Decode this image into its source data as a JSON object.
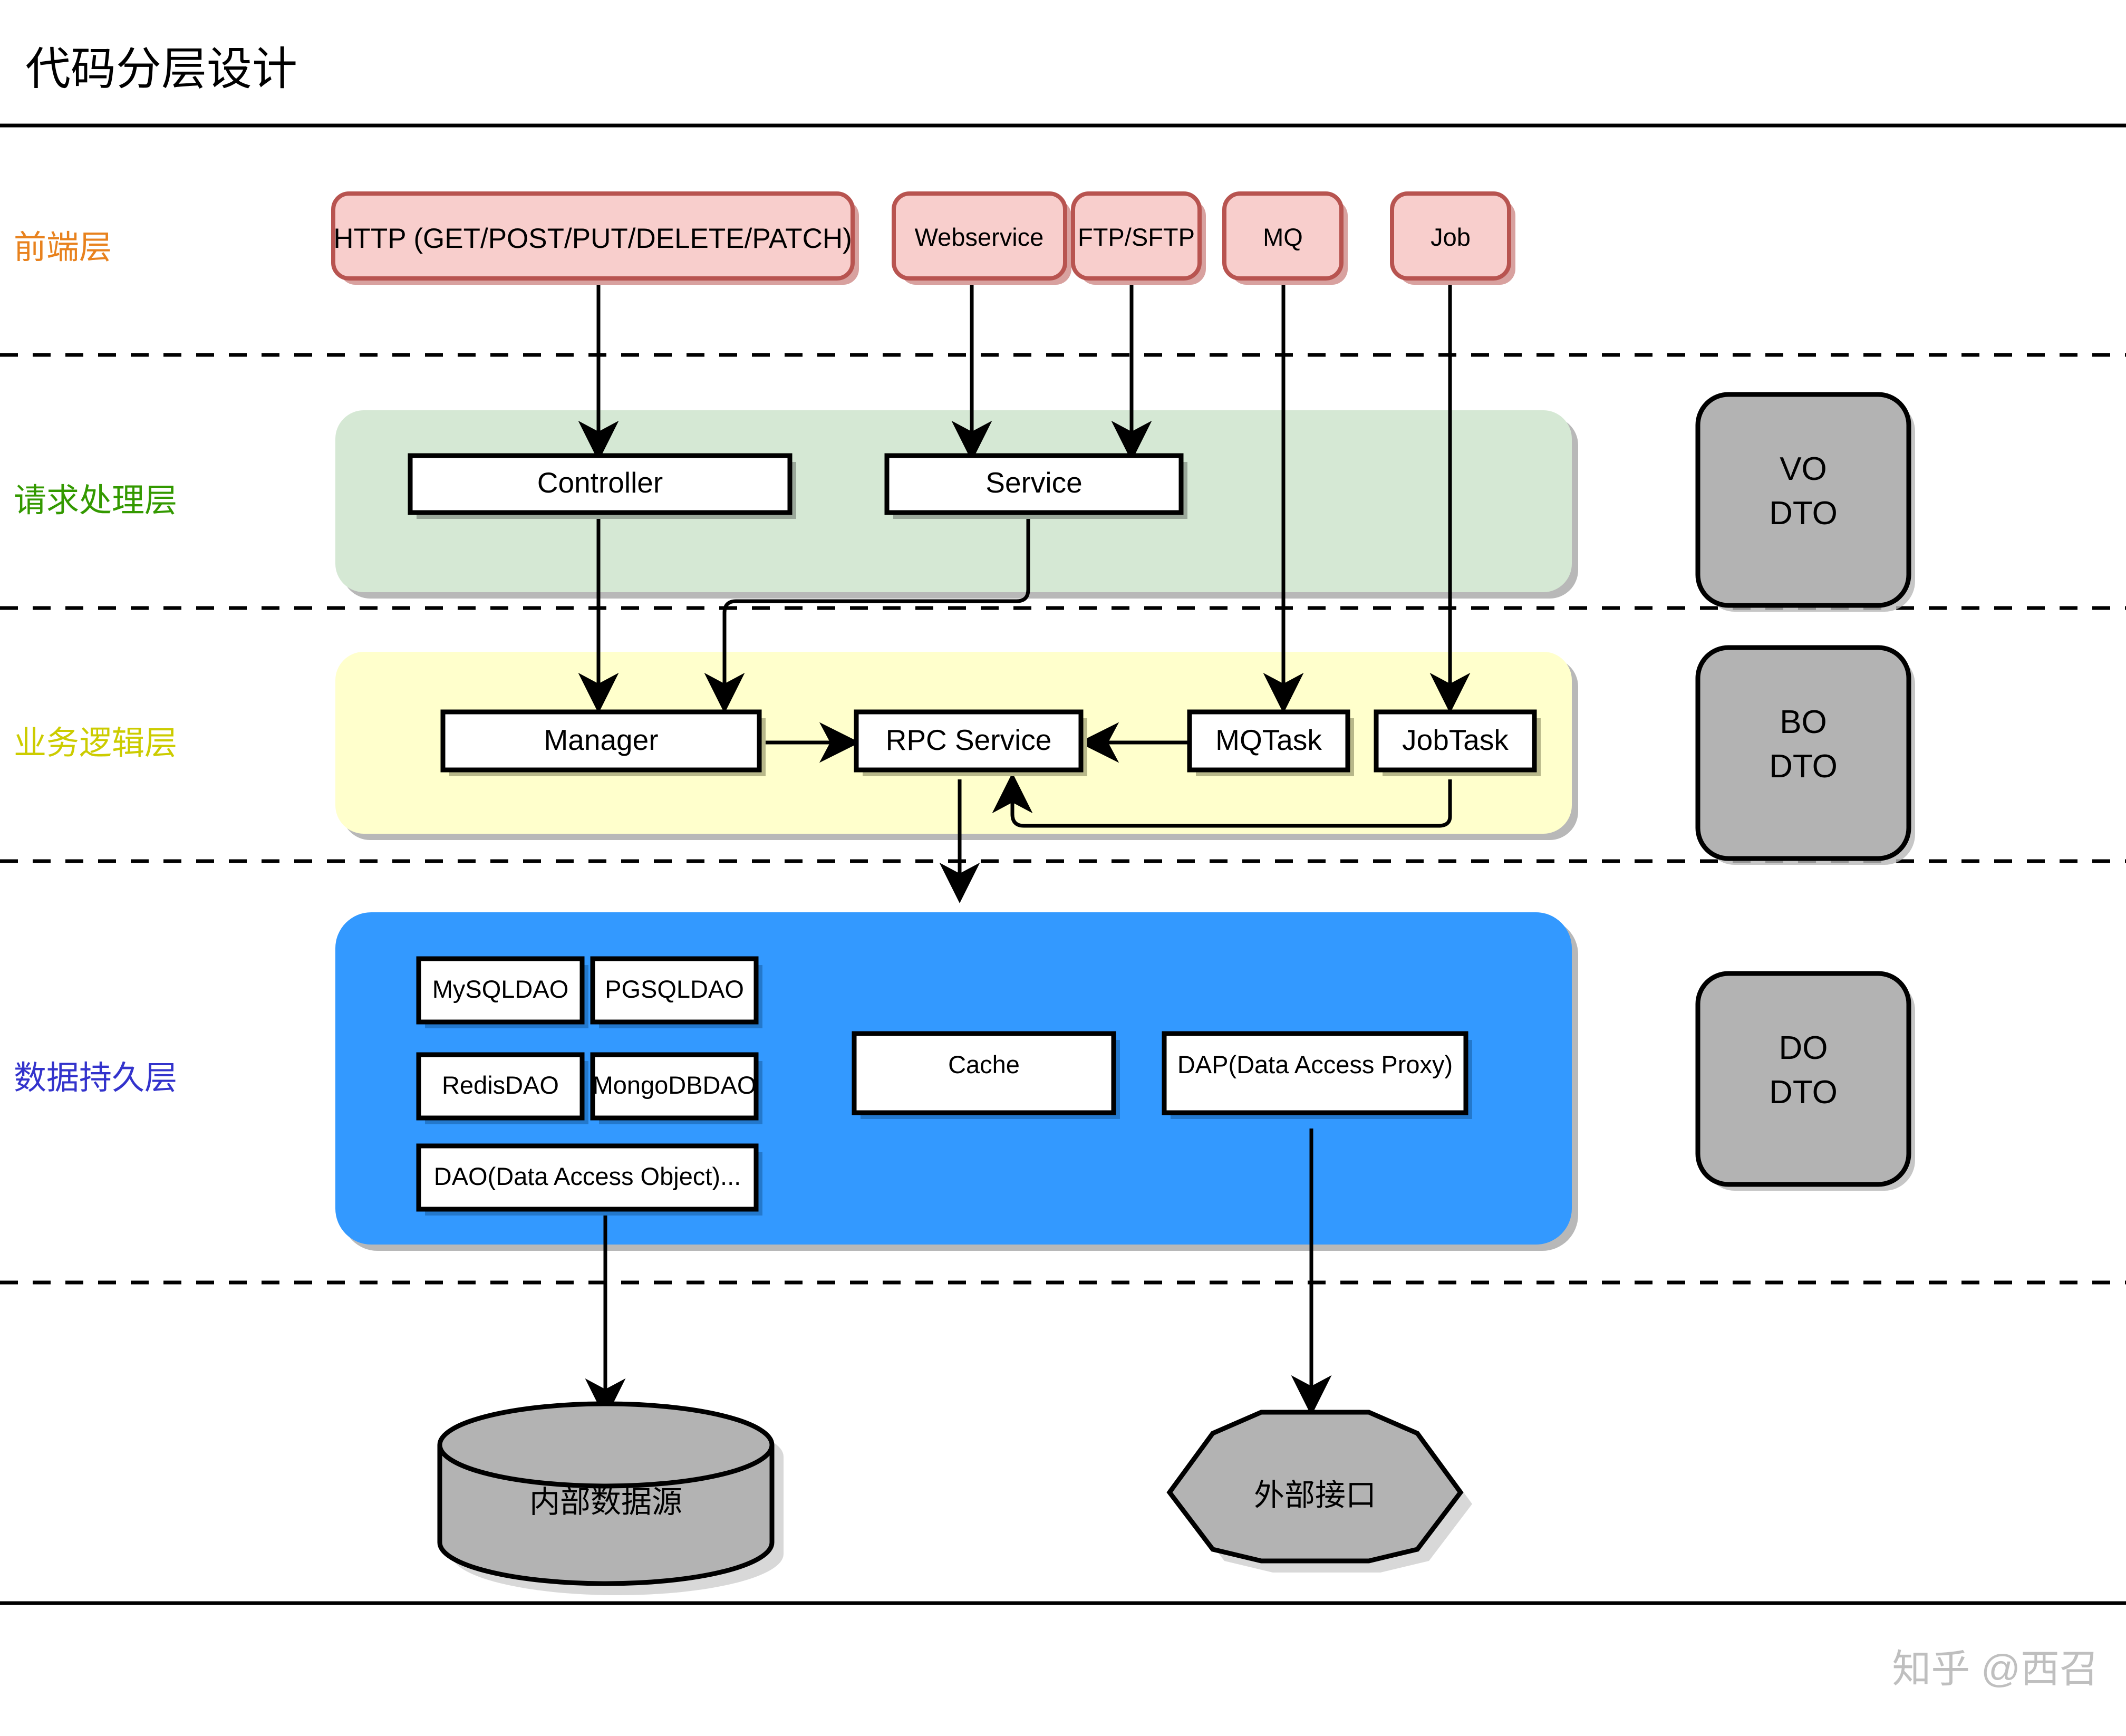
{
  "page": {
    "title": "代码分层设计",
    "watermark": "知乎 @西召"
  },
  "colors": {
    "frontend_fill": "#f8cecc",
    "frontend_stroke": "#b85450",
    "request_band": "#d5e8d4",
    "business_band": "#ffffcc",
    "persistence_band": "#3399ff",
    "dto_fill": "#b3b3b3",
    "dto_stroke": "#000000",
    "node_fill": "#ffffff",
    "node_stroke": "#000000",
    "shadow": "#b8b8b8",
    "label_frontend": "#e8821e",
    "label_request": "#339900",
    "label_business": "#cccc00",
    "label_persistence": "#3333cc",
    "watermark": "#bfbfbf",
    "rule": "#000000"
  },
  "layer_labels": [
    {
      "id": "frontend",
      "text": "前端层",
      "color": "#e8821e"
    },
    {
      "id": "request",
      "text": "请求处理层",
      "color": "#339900"
    },
    {
      "id": "business",
      "text": "业务逻辑层",
      "color": "#cccc00"
    },
    {
      "id": "persistence",
      "text": "数据持久层",
      "color": "#3333cc"
    }
  ],
  "frontend_nodes": [
    {
      "id": "http",
      "label": "HTTP (GET/POST/PUT/DELETE/PATCH)"
    },
    {
      "id": "webservice",
      "label": "Webservice"
    },
    {
      "id": "ftp",
      "label": "FTP/SFTP"
    },
    {
      "id": "mq",
      "label": "MQ"
    },
    {
      "id": "job",
      "label": "Job"
    }
  ],
  "request_nodes": [
    {
      "id": "controller",
      "label": "Controller"
    },
    {
      "id": "service",
      "label": "Service"
    }
  ],
  "business_nodes": [
    {
      "id": "manager",
      "label": "Manager"
    },
    {
      "id": "rpc-service",
      "label": "RPC Service"
    },
    {
      "id": "mqtask",
      "label": "MQTask"
    },
    {
      "id": "jobtask",
      "label": "JobTask"
    }
  ],
  "persistence_nodes": [
    {
      "id": "mysqldao",
      "label": "MySQLDAO"
    },
    {
      "id": "pgsqldao",
      "label": "PGSQLDAO"
    },
    {
      "id": "redisdao",
      "label": "RedisDAO"
    },
    {
      "id": "mongodbdao",
      "label": "MongoDBDAO"
    },
    {
      "id": "dao",
      "label": "DAO(Data Access Object)..."
    },
    {
      "id": "cache",
      "label": "Cache"
    },
    {
      "id": "dap",
      "label": "DAP(Data Access Proxy)"
    }
  ],
  "dto_nodes": [
    {
      "id": "vo-dto",
      "line1": "VO",
      "line2": "DTO"
    },
    {
      "id": "bo-dto",
      "line1": "BO",
      "line2": "DTO"
    },
    {
      "id": "do-dto",
      "line1": "DO",
      "line2": "DTO"
    }
  ],
  "datastore_nodes": [
    {
      "id": "internal-datasource",
      "label": "内部数据源",
      "shape": "cylinder"
    },
    {
      "id": "external-interface",
      "label": "外部接口",
      "shape": "hexagon"
    }
  ],
  "edges": [
    {
      "from": "http",
      "to": "controller"
    },
    {
      "from": "webservice",
      "to": "service"
    },
    {
      "from": "ftp",
      "to": "service"
    },
    {
      "from": "mq",
      "to": "mqtask"
    },
    {
      "from": "job",
      "to": "jobtask"
    },
    {
      "from": "controller",
      "to": "manager"
    },
    {
      "from": "service",
      "to": "manager"
    },
    {
      "from": "manager",
      "to": "rpc-service"
    },
    {
      "from": "mqtask",
      "to": "rpc-service"
    },
    {
      "from": "jobtask",
      "to": "rpc-service"
    },
    {
      "from": "rpc-service",
      "to": "dao"
    },
    {
      "from": "dao",
      "to": "internal-datasource"
    },
    {
      "from": "dap",
      "to": "external-interface"
    }
  ]
}
